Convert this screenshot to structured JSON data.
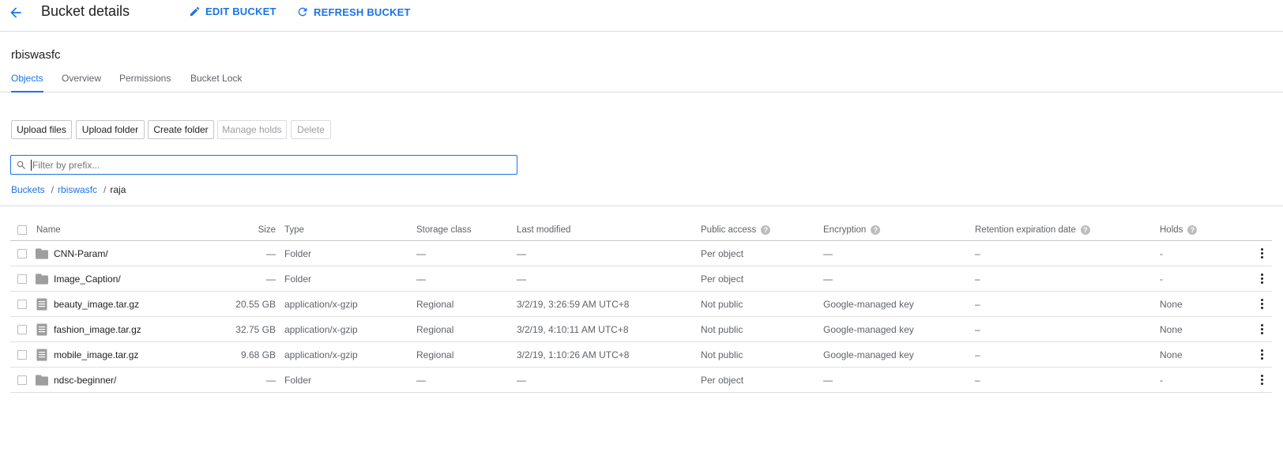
{
  "header": {
    "title": "Bucket details",
    "edit_label": "EDIT BUCKET",
    "refresh_label": "REFRESH BUCKET"
  },
  "bucket": {
    "name": "rbiswasfc"
  },
  "tabs": [
    {
      "label": "Objects",
      "active": true
    },
    {
      "label": "Overview",
      "active": false
    },
    {
      "label": "Permissions",
      "active": false
    },
    {
      "label": "Bucket Lock",
      "active": false
    }
  ],
  "actions": {
    "upload_files": "Upload files",
    "upload_folder": "Upload folder",
    "create_folder": "Create folder",
    "manage_holds": "Manage holds",
    "delete": "Delete"
  },
  "filter": {
    "placeholder": "Filter by prefix..."
  },
  "breadcrumb": {
    "root": "Buckets",
    "sep": "/",
    "bucket": "rbiswasfc",
    "current": "raja"
  },
  "table": {
    "columns": {
      "name": "Name",
      "size": "Size",
      "type": "Type",
      "storage_class": "Storage class",
      "last_modified": "Last modified",
      "public_access": "Public access",
      "encryption": "Encryption",
      "retention": "Retention expiration date",
      "holds": "Holds"
    },
    "rows": [
      {
        "icon": "folder-icon",
        "name": "CNN-Param/",
        "size": "—",
        "type": "Folder",
        "storage_class": "—",
        "last_modified": "—",
        "public_access": "Per object",
        "encryption": "—",
        "retention": "–",
        "holds": "-"
      },
      {
        "icon": "folder-icon",
        "name": "Image_Caption/",
        "size": "—",
        "type": "Folder",
        "storage_class": "—",
        "last_modified": "—",
        "public_access": "Per object",
        "encryption": "—",
        "retention": "–",
        "holds": "-"
      },
      {
        "icon": "file-icon",
        "name": "beauty_image.tar.gz",
        "size": "20.55 GB",
        "type": "application/x-gzip",
        "storage_class": "Regional",
        "last_modified": "3/2/19, 3:26:59 AM UTC+8",
        "public_access": "Not public",
        "encryption": "Google-managed key",
        "retention": "–",
        "holds": "None"
      },
      {
        "icon": "file-icon",
        "name": "fashion_image.tar.gz",
        "size": "32.75 GB",
        "type": "application/x-gzip",
        "storage_class": "Regional",
        "last_modified": "3/2/19, 4:10:11 AM UTC+8",
        "public_access": "Not public",
        "encryption": "Google-managed key",
        "retention": "–",
        "holds": "None"
      },
      {
        "icon": "file-icon",
        "name": "mobile_image.tar.gz",
        "size": "9.68 GB",
        "type": "application/x-gzip",
        "storage_class": "Regional",
        "last_modified": "3/2/19, 1:10:26 AM UTC+8",
        "public_access": "Not public",
        "encryption": "Google-managed key",
        "retention": "–",
        "holds": "None"
      },
      {
        "icon": "folder-icon",
        "name": "ndsc-beginner/",
        "size": "—",
        "type": "Folder",
        "storage_class": "—",
        "last_modified": "—",
        "public_access": "Per object",
        "encryption": "—",
        "retention": "–",
        "holds": "-"
      }
    ]
  },
  "colors": {
    "accent": "#1a73e8",
    "text": "#202124",
    "muted": "#5f6368",
    "divider": "#dadce0"
  }
}
